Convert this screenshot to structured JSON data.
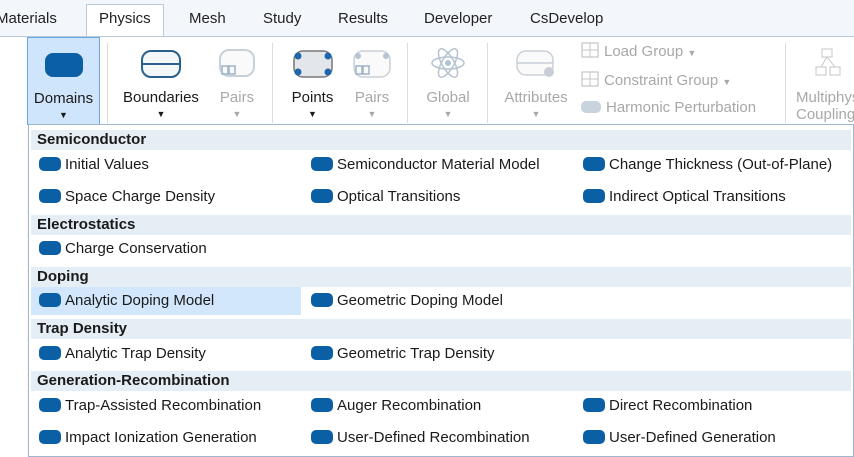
{
  "tabs": [
    {
      "label": "Materials"
    },
    {
      "label": "Physics"
    },
    {
      "label": "Mesh"
    },
    {
      "label": "Study"
    },
    {
      "label": "Results"
    },
    {
      "label": "Developer"
    },
    {
      "label": "CsDevelop"
    }
  ],
  "ribbon": {
    "domains": "Domains",
    "boundaries": "Boundaries",
    "pairs1": "Pairs",
    "points": "Points",
    "pairs2": "Pairs",
    "global": "Global",
    "attributes": "Attributes",
    "load_group": "Load Group",
    "constraint_group": "Constraint Group",
    "harmonic_perturbation": "Harmonic Perturbation",
    "multiphysics": "Multiphysics Couplings"
  },
  "menu": {
    "sections": [
      {
        "title": "Semiconductor",
        "items": [
          "Initial Values",
          "Semiconductor Material Model",
          "Change Thickness (Out-of-Plane)",
          "Space Charge Density",
          "Optical Transitions",
          "Indirect Optical Transitions"
        ]
      },
      {
        "title": "Electrostatics",
        "items": [
          "Charge Conservation"
        ]
      },
      {
        "title": "Doping",
        "items": [
          "Analytic Doping Model",
          "Geometric Doping Model"
        ]
      },
      {
        "title": "Trap Density",
        "items": [
          "Analytic Trap Density",
          "Geometric Trap Density"
        ]
      },
      {
        "title": "Generation-Recombination",
        "items": [
          "Trap-Assisted Recombination",
          "Auger Recombination",
          "Direct Recombination",
          "Impact Ionization Generation",
          "User-Defined Recombination",
          "User-Defined Generation"
        ]
      }
    ]
  },
  "colors": {
    "accent": "#0b5fa5",
    "selected_bg": "#cfe5fb",
    "hover_bg": "#d2e7fb",
    "section_bg": "#e5edf5"
  }
}
